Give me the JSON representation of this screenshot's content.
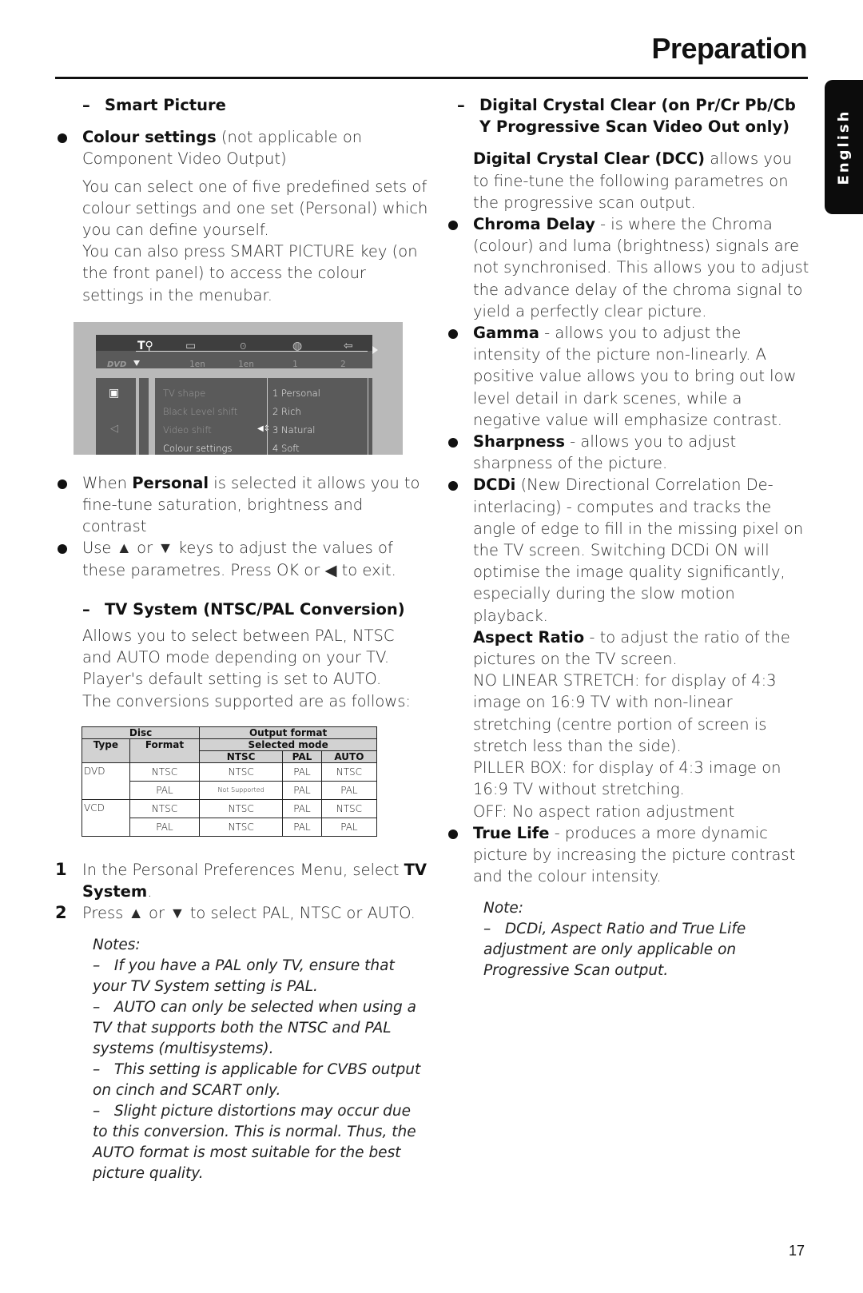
{
  "header": {
    "title": "Preparation",
    "language_tab": "English"
  },
  "left": {
    "smart_picture_heading": "Smart Picture",
    "colour_settings": {
      "bold": "Colour settings",
      "rest_line1": " (not applicable on",
      "rest_line2": "Component Video Output)"
    },
    "colour_para1": "You can select one of five predefined sets of colour settings and one set (Personal) which you can define yourself.",
    "colour_para2": "You can also press SMART PICTURE key (on the front panel) to access the colour settings in the menubar.",
    "osd": {
      "icons": [
        "settings-tools-icon",
        "subtitle-icon",
        "audio-icon",
        "angle-icon",
        "speaker-icon"
      ],
      "icon_glyphs": [
        "T⚲",
        "▭",
        "ꙩ",
        "◍",
        "⇦"
      ],
      "disc_label": "DVD",
      "values": [
        "1en",
        "1en",
        "1",
        "2"
      ],
      "menu_items": [
        "TV shape",
        "Black Level shift",
        "Video shift",
        "Colour settings"
      ],
      "active_item": "Colour settings",
      "options": [
        "1 Personal",
        "2 Rich",
        "3 Natural",
        "4 Soft"
      ],
      "side_icons": [
        "picture-icon",
        "sound-icon"
      ]
    },
    "bullet_personal": {
      "pre": "When ",
      "bold": "Personal",
      "post": " is selected it allows you to fine-tune saturation, brightness and contrast"
    },
    "bullet_use": {
      "pre": "Use ",
      "up": "▲",
      "mid": " or ",
      "down": "▼",
      "post": " keys to adjust the values of these parametres. Press OK or ",
      "left": "◀",
      "end": " to exit."
    },
    "tv_system_heading": "TV System (NTSC/PAL Conversion)",
    "tv_para1": "Allows you to select between PAL, NTSC and AUTO mode depending on your TV. Player's default setting is set to AUTO.",
    "tv_para2": "The conversions supported are as follows:",
    "table": {
      "group_disc": "Disc",
      "group_output": "Output format",
      "col_type": "Type",
      "col_format": "Format",
      "selected_mode": "Selected mode",
      "modes": [
        "NTSC",
        "PAL",
        "AUTO"
      ],
      "rows": [
        {
          "type": "DVD",
          "format": "NTSC",
          "ntsc": "NTSC",
          "pal": "PAL",
          "auto": "NTSC"
        },
        {
          "type": "",
          "format": "PAL",
          "ntsc": "Not Supported",
          "pal": "PAL",
          "auto": "PAL"
        },
        {
          "type": "VCD",
          "format": "NTSC",
          "ntsc": "NTSC",
          "pal": "PAL",
          "auto": "NTSC"
        },
        {
          "type": "",
          "format": "PAL",
          "ntsc": "NTSC",
          "pal": "PAL",
          "auto": "PAL"
        }
      ]
    },
    "steps": [
      {
        "num": "1",
        "pre": "In the Personal Preferences Menu, select ",
        "bold": "TV System",
        "post": "."
      },
      {
        "num": "2",
        "pre": "Press ",
        "up": "▲",
        "mid": " or ",
        "down": "▼",
        "post": " to select PAL, NTSC or AUTO."
      }
    ],
    "notes_title": "Notes:",
    "notes": [
      "If you have a PAL only TV, ensure that your TV System setting is PAL.",
      "AUTO can only be selected when using a TV that supports both the NTSC and PAL systems (multisystems).",
      "This setting is applicable for CVBS output on cinch and SCART only.",
      "Slight picture distortions may occur due to this conversion. This is normal. Thus, the AUTO format is most suitable for the best picture quality."
    ]
  },
  "right": {
    "dcc_heading": "Digital Crystal Clear (on Pr/Cr Pb/Cb Y Progressive Scan Video Out only)",
    "dcc_intro": {
      "bold": "Digital Crystal Clear (DCC)",
      "rest": " allows you to fine-tune the following parametres on the progressive scan output."
    },
    "bullets": [
      {
        "bold": "Chroma Delay",
        "rest": " - is where the Chroma (colour) and luma (brightness) signals are not synchronised. This allows you to adjust the advance delay of the chroma signal to yield a perfectly clear picture."
      },
      {
        "bold": "Gamma",
        "rest": " - allows you to adjust the intensity of the picture non-linearly. A positive value allows you to bring out low level detail in dark scenes, while a negative value will emphasize contrast."
      },
      {
        "bold": "Sharpness",
        "rest": " - allows you to adjust sharpness of the picture."
      },
      {
        "bold": "DCDi",
        "rest": " (New Directional Correlation De-interlacing) - computes and tracks the angle of edge to fill in the missing pixel on the TV screen. Switching DCDi ON will optimise the image quality significantly, especially during the slow motion playback."
      }
    ],
    "aspect": {
      "bold": "Aspect Ratio",
      "rest": " - to adjust the ratio of the pictures on the TV screen."
    },
    "aspect_options": [
      "NO LINEAR STRETCH: for display of 4:3 image on 16:9 TV with non-linear stretching (centre portion of screen is stretch less than the side).",
      "PILLER BOX: for display of 4:3 image on 16:9 TV without stretching.",
      "OFF: No aspect ration adjustment"
    ],
    "true_life": {
      "bold": "True Life",
      "rest": " - produces a more dynamic picture by increasing the picture contrast and the colour intensity."
    },
    "note_title": "Note:",
    "note": "DCDi, Aspect Ratio and True Life adjustment are only applicable on Progressive Scan output."
  },
  "footer": {
    "page_number": "17"
  }
}
